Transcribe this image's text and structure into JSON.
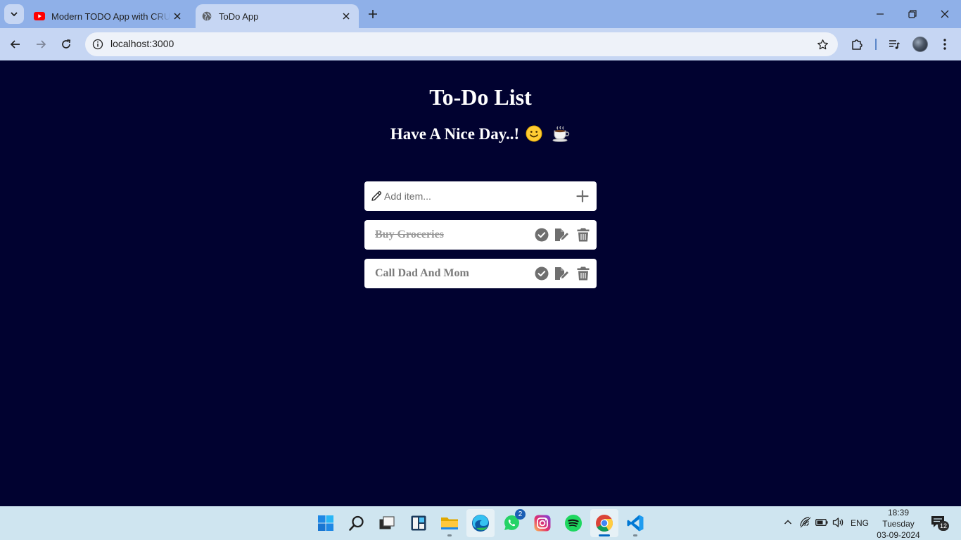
{
  "browser": {
    "tabs": [
      {
        "title": "Modern TODO App with CRUD",
        "favicon": "youtube-icon",
        "active": false
      },
      {
        "title": "ToDo App",
        "favicon": "globe-icon",
        "active": true
      }
    ],
    "url": "localhost:3000"
  },
  "app": {
    "title": "To-Do List",
    "subtitle": "Have A Nice Day..!",
    "subtitle_emojis": [
      "🙂",
      "☕"
    ],
    "input_placeholder": "Add item...",
    "todos": [
      {
        "text": "Buy Groceries",
        "completed": true
      },
      {
        "text": "Call Dad And Mom",
        "completed": false
      }
    ]
  },
  "taskbar": {
    "apps": [
      "start",
      "search",
      "task-view",
      "widgets",
      "file-explorer",
      "edge",
      "whatsapp",
      "instagram",
      "spotify",
      "chrome",
      "vscode"
    ],
    "whatsapp_badge": "2",
    "language": "ENG",
    "time": "18:39",
    "day": "Tuesday",
    "date": "03-09-2024",
    "notification_count": "12"
  },
  "colors": {
    "page_background": "#010230",
    "card_background": "#ffffff",
    "icon_gray": "#6f6f6f",
    "tab_strip": "#8fb0e8",
    "toolbar": "#c6d6f3"
  }
}
